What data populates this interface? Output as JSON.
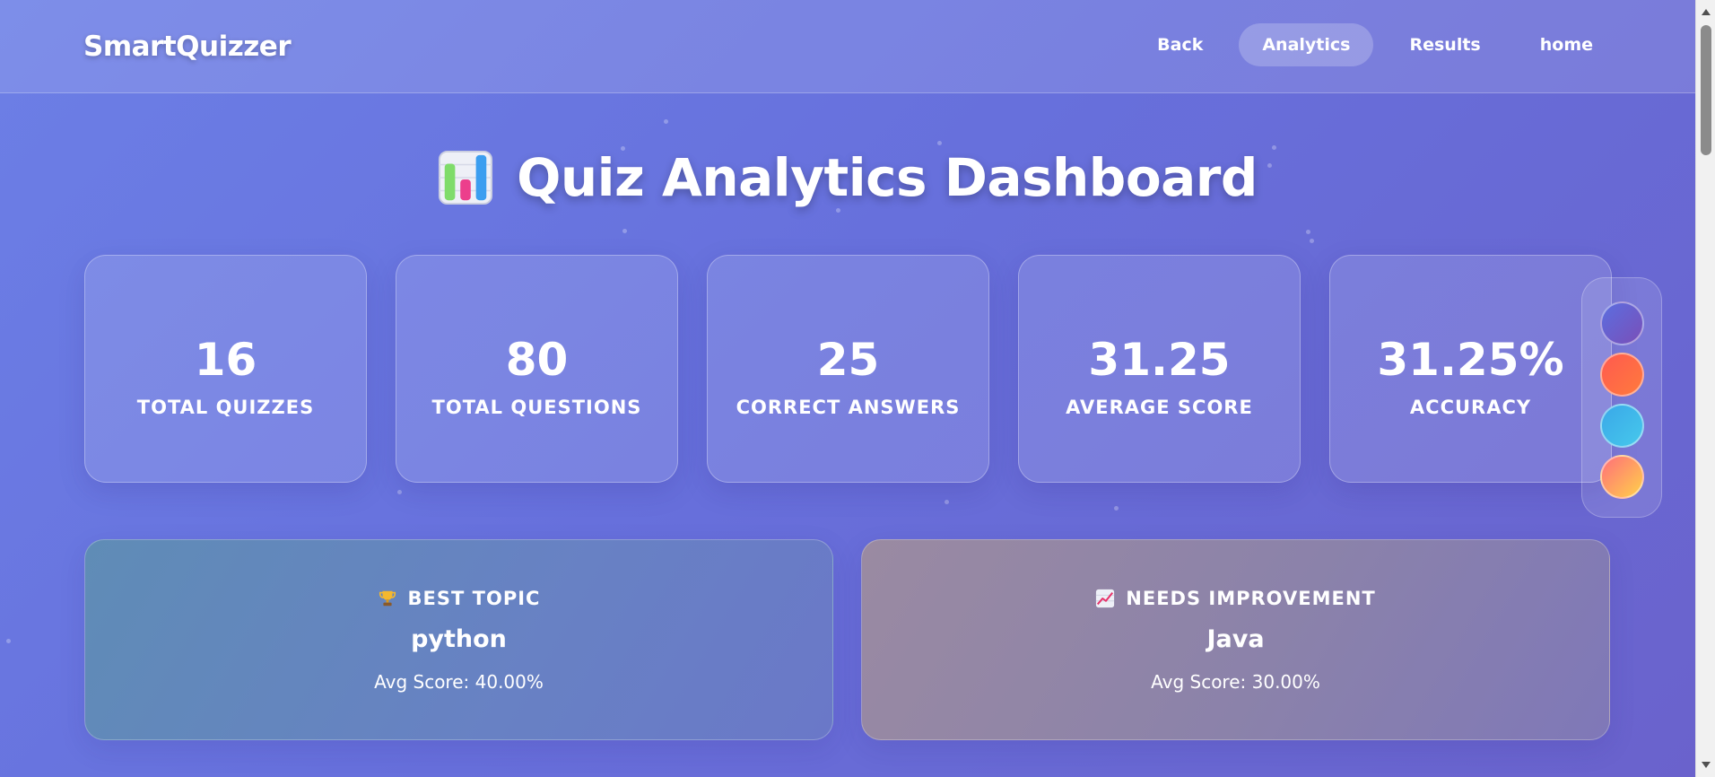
{
  "brand": "SmartQuizzer",
  "nav": [
    {
      "label": "Back",
      "active": false
    },
    {
      "label": "Analytics",
      "active": true
    },
    {
      "label": "Results",
      "active": false
    },
    {
      "label": "home",
      "active": false
    }
  ],
  "page": {
    "title": "Quiz Analytics Dashboard",
    "title_icon": "bar-chart-icon"
  },
  "stats": [
    {
      "value": "16",
      "label": "TOTAL QUIZZES"
    },
    {
      "value": "80",
      "label": "TOTAL QUESTIONS"
    },
    {
      "value": "25",
      "label": "CORRECT ANSWERS"
    },
    {
      "value": "31.25",
      "label": "AVERAGE SCORE"
    },
    {
      "value": "31.25%",
      "label": "ACCURACY"
    }
  ],
  "themes": [
    {
      "name": "purple",
      "color_from": "#5b6ee0",
      "color_to": "#7a4fb8"
    },
    {
      "name": "red",
      "color_from": "#ff5a4f",
      "color_to": "#ff7a3d"
    },
    {
      "name": "blue",
      "color_from": "#3aa8e8",
      "color_to": "#46c8ec"
    },
    {
      "name": "sunset",
      "color_from": "#ff6f7a",
      "color_to": "#ffd04a"
    }
  ],
  "best_topic": {
    "icon": "trophy-icon",
    "heading": "BEST TOPIC",
    "name": "python",
    "score": "Avg Score: 40.00%"
  },
  "needs_improvement": {
    "icon": "chart-increasing-icon",
    "heading": "NEEDS IMPROVEMENT",
    "name": "Java",
    "score": "Avg Score: 30.00%"
  }
}
